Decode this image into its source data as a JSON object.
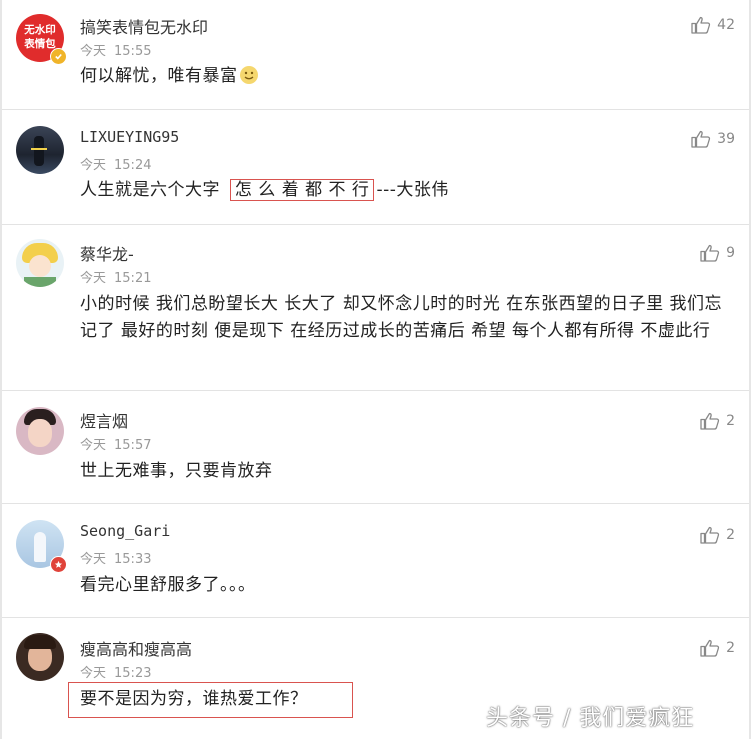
{
  "comments": [
    {
      "username": "搞笑表情包无水印",
      "day": "今天",
      "time": "15:55",
      "text": "何以解忧，唯有暴富",
      "likes": "42",
      "avatar_text_1": "无水印",
      "avatar_text_2": "表情包",
      "badge": "verified"
    },
    {
      "username": "LIXUEYING95",
      "day": "今天",
      "time": "15:24",
      "text_before": "人生就是六个大字",
      "text_highlight": "怎 么 着 都 不 行",
      "text_after": "---大张伟",
      "likes": "39"
    },
    {
      "username": "蔡华龙-",
      "day": "今天",
      "time": "15:21",
      "text": "小的时候 我们总盼望长大 长大了 却又怀念儿时的时光 在东张西望的日子里 我们忘记了 最好的时刻 便是现下 在经历过成长的苦痛后 希望 每个人都有所得 不虚此行",
      "likes": "9"
    },
    {
      "username": "煜言烟",
      "day": "今天",
      "time": "15:57",
      "text": "世上无难事，只要肯放弃",
      "likes": "2"
    },
    {
      "username": "Seong_Gari",
      "day": "今天",
      "time": "15:33",
      "text": "看完心里舒服多了。。。",
      "likes": "2",
      "badge": "red"
    },
    {
      "username": "瘦高高和瘦高高",
      "day": "今天",
      "time": "15:23",
      "text": "要不是因为穷，谁热爱工作？",
      "likes": "2"
    }
  ],
  "watermark": "头条号 / 我们爱疯狂",
  "colors": {
    "highlight_border": "#d9534f",
    "verified_badge": "#f0b429",
    "red_badge": "#e0433a",
    "like_icon": "#888888"
  },
  "icons": [
    "thumbs-up-icon",
    "verified-badge-icon",
    "smile-emoji-icon"
  ]
}
